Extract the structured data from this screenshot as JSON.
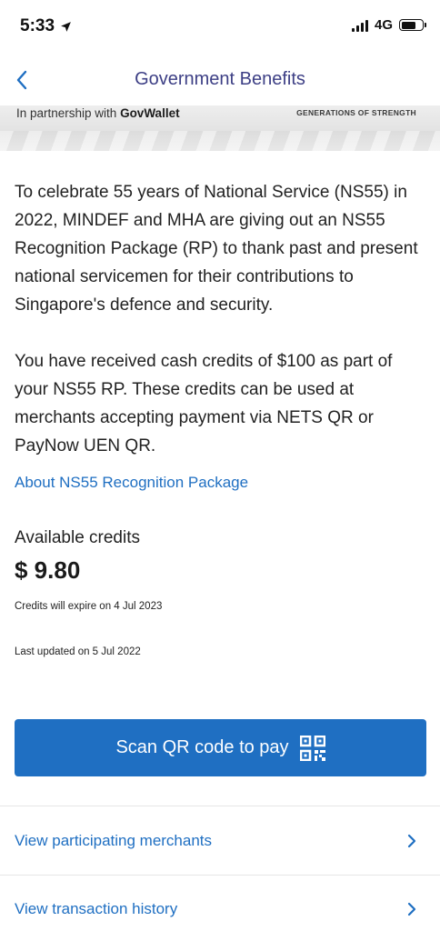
{
  "status_bar": {
    "time": "5:33",
    "network": "4G"
  },
  "nav": {
    "title": "Government Benefits"
  },
  "banner": {
    "partnership_prefix": "In partnership with ",
    "partner_name": "GovWallet",
    "tagline": "GENERATIONS OF STRENGTH"
  },
  "content": {
    "intro": "To celebrate 55 years of National Service (NS55) in 2022, MINDEF and MHA are giving out an NS55 Recognition Package (RP) to thank past and present national servicemen for their contributions to Singapore's defence and security.",
    "credits_info": "You have received cash credits of $100 as part of your NS55 RP. These credits can be used at merchants accepting payment via NETS QR or PayNow UEN QR.",
    "about_link": "About NS55 Recognition Package",
    "credits_label": "Available credits",
    "credits_amount": "$ 9.80",
    "expiry": "Credits will expire on 4 Jul 2023",
    "last_updated": "Last updated on 5 Jul 2022"
  },
  "actions": {
    "scan_label": "Scan QR code to pay"
  },
  "links": [
    {
      "label": "View participating merchants"
    },
    {
      "label": "View transaction history"
    }
  ],
  "colors": {
    "accent": "#1f6fc2",
    "title": "#3d3f85",
    "text": "#222222"
  }
}
